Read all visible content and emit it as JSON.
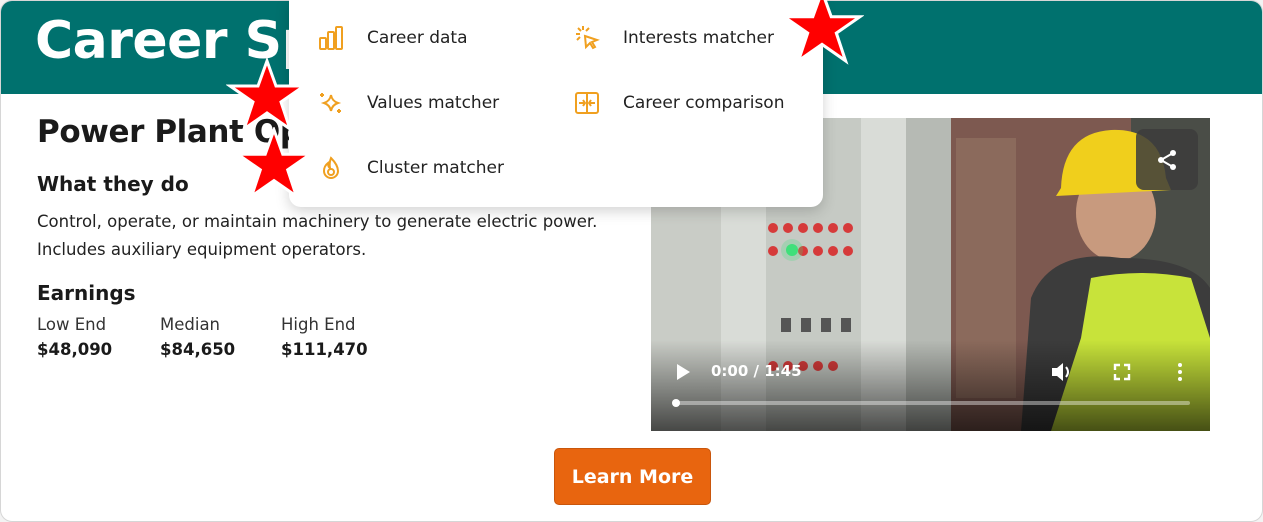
{
  "banner": {
    "title": "Career Sp"
  },
  "career": {
    "name": "Power Plant Op",
    "what_heading": "What they do",
    "description": "Control, operate, or maintain machinery to generate electric power. Includes auxiliary equipment operators.",
    "earnings_heading": "Earnings",
    "earnings": [
      {
        "label": "Low End",
        "value": "$48,090"
      },
      {
        "label": "Median",
        "value": "$84,650"
      },
      {
        "label": "High End",
        "value": "$111,470"
      }
    ]
  },
  "video": {
    "time": "0:00 / 1:45",
    "progress": 0,
    "icons": [
      "play-icon",
      "volume-icon",
      "fullscreen-icon",
      "more-options-icon",
      "share-icon"
    ]
  },
  "cta": {
    "label": "Learn More"
  },
  "menu": {
    "items": [
      {
        "label": "Career data",
        "icon": "bar-chart-icon"
      },
      {
        "label": "Interests matcher",
        "icon": "cursor-click-icon"
      },
      {
        "label": "Values matcher",
        "icon": "sparkle-icon"
      },
      {
        "label": "Career comparison",
        "icon": "compare-icon"
      },
      {
        "label": "Cluster matcher",
        "icon": "flame-icon"
      }
    ]
  },
  "colors": {
    "banner": "#00716e",
    "accent": "#e8650f",
    "icon": "#f0a020",
    "marker": "#ff0000"
  }
}
